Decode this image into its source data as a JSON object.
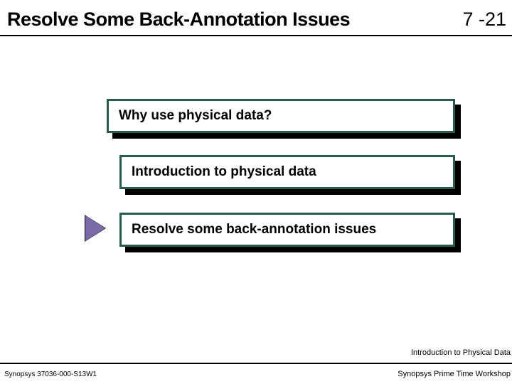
{
  "header": {
    "title": "Resolve Some Back-Annotation Issues",
    "page_number": "7 -21"
  },
  "items": [
    {
      "label": "Why use physical data?"
    },
    {
      "label": "Introduction to physical data"
    },
    {
      "label": "Resolve some back-annotation issues"
    }
  ],
  "footer": {
    "section": "Introduction to Physical Data",
    "doc_id": "Synopsys 37036-000-S13W1",
    "workshop": "Synopsys Prime Time Workshop"
  }
}
